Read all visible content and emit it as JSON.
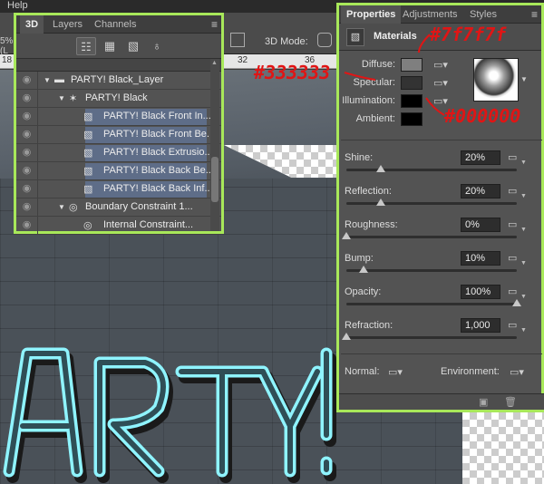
{
  "app": {
    "menu_item": "Help",
    "doc_tab": "5% (L",
    "mode_label": "3D Mode:"
  },
  "ruler": {
    "ticks": [
      "18",
      "32",
      "36"
    ]
  },
  "panel_3d": {
    "tabs": [
      "3D",
      "Layers",
      "Channels"
    ],
    "active_tab": "3D",
    "layers": [
      {
        "label": "PARTY! Black_Layer",
        "indent": 0,
        "icon": "folder-icon",
        "highlight": false
      },
      {
        "label": "PARTY! Black",
        "indent": 1,
        "icon": "mesh-icon",
        "highlight": false
      },
      {
        "label": "PARTY! Black Front In...",
        "indent": 2,
        "icon": "material-icon",
        "highlight": true
      },
      {
        "label": "PARTY! Black Front Be...",
        "indent": 2,
        "icon": "material-icon",
        "highlight": true
      },
      {
        "label": "PARTY! Black Extrusio...",
        "indent": 2,
        "icon": "material-icon",
        "highlight": true
      },
      {
        "label": "PARTY! Black Back Be...",
        "indent": 2,
        "icon": "material-icon",
        "highlight": true
      },
      {
        "label": "PARTY! Black Back Inf...",
        "indent": 2,
        "icon": "material-icon",
        "highlight": true
      },
      {
        "label": "Boundary Constraint 1...",
        "indent": 1,
        "icon": "constraint-icon",
        "highlight": false
      },
      {
        "label": "Internal Constraint...",
        "indent": 2,
        "icon": "constraint-icon",
        "highlight": false
      }
    ]
  },
  "properties": {
    "tabs": [
      "Properties",
      "Adjustments",
      "Styles"
    ],
    "active_tab": "Properties",
    "section_title": "Materials",
    "swatches": [
      {
        "label": "Diffuse:",
        "color": "#7f7f7f"
      },
      {
        "label": "Specular:",
        "color": "#333333"
      },
      {
        "label": "Illumination:",
        "color": "#000000"
      },
      {
        "label": "Ambient:",
        "color": "#000000"
      }
    ],
    "sliders": [
      {
        "label": "Shine:",
        "value": "20%",
        "level": 0.2
      },
      {
        "label": "Reflection:",
        "value": "20%",
        "level": 0.2
      },
      {
        "label": "Roughness:",
        "value": "0%",
        "level": 0.0
      },
      {
        "label": "Bump:",
        "value": "10%",
        "level": 0.1
      },
      {
        "label": "Opacity:",
        "value": "100%",
        "level": 1.0
      },
      {
        "label": "Refraction:",
        "value": "1,000",
        "level": 0.0
      }
    ],
    "normal_label": "Normal:",
    "environment_label": "Environment:"
  },
  "annotations": {
    "diffuse": "#7f7f7f",
    "specular": "#333333",
    "illumination": "#000000"
  },
  "colors": {
    "panel_border": "#a8e85a",
    "highlight_row": "#5e6d88",
    "neon": "#8ff4ff",
    "annotation": "#e01515"
  }
}
